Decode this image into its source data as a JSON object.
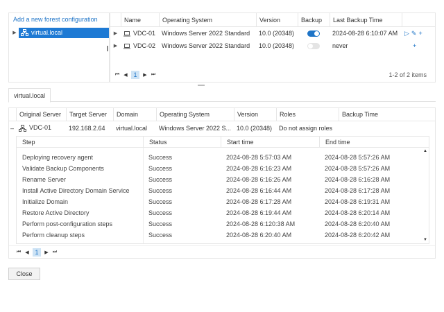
{
  "forest": {
    "add_link": "Add a new forest configuration",
    "tree": [
      {
        "label": "virtual.local",
        "selected": true
      }
    ]
  },
  "servers": {
    "columns": [
      "Name",
      "Operating System",
      "Version",
      "Backup",
      "Last Backup Time"
    ],
    "rows": [
      {
        "name": "VDC-01",
        "os": "Windows Server 2022 Standard",
        "version": "10.0 (20348)",
        "backup": true,
        "last_backup": "2024-08-28 6:10:07 AM"
      },
      {
        "name": "VDC-02",
        "os": "Windows Server 2022 Standard",
        "version": "10.0 (20348)",
        "backup": false,
        "last_backup": "never"
      }
    ],
    "pager": {
      "page": "1",
      "info": "1-2 of 2 items"
    }
  },
  "tabs": [
    {
      "label": "virtual.local"
    }
  ],
  "details": {
    "columns": [
      "Original Server",
      "Target Server",
      "Domain",
      "Operating System",
      "Version",
      "Roles",
      "Backup Time"
    ],
    "row": {
      "original_server": "VDC-01",
      "target_server": "192.168.2.64",
      "domain": "virtual.local",
      "os": "Windows Server 2022 S...",
      "version": "10.0 (20348)",
      "roles": "Do not assign roles",
      "backup_time": ""
    },
    "steps": {
      "columns": [
        "Step",
        "Status",
        "Start time",
        "End time"
      ],
      "rows": [
        {
          "step": "Deploying recovery agent",
          "status": "Success",
          "start": "2024-08-28 5:57:03 AM",
          "end": "2024-08-28 5:57:26 AM"
        },
        {
          "step": "Validate Backup Components",
          "status": "Success",
          "start": "2024-08-28 6:16:23 AM",
          "end": "2024-08-28 5:57:26 AM"
        },
        {
          "step": "Rename Server",
          "status": "Success",
          "start": "2024-08-28 6:16:26 AM",
          "end": "2024-08-28 6:16:28 AM"
        },
        {
          "step": "Install Active Directory Domain Service",
          "status": "Success",
          "start": "2024-08-28 6:16:44 AM",
          "end": "2024-08-28 6:17:28 AM"
        },
        {
          "step": "Initialize Domain",
          "status": "Success",
          "start": "2024-08-28 6:17:28 AM",
          "end": "2024-08-28 6:19:31 AM"
        },
        {
          "step": "Restore Active Directory",
          "status": "Success",
          "start": "2024-08-28 6:19:44 AM",
          "end": "2024-08-28 6:20:14 AM"
        },
        {
          "step": "Perform post-configuration steps",
          "status": "Success",
          "start": "2024-08-28 6:120:38 AM",
          "end": "2024-08-28 6:20:40 AM"
        },
        {
          "step": "Perform cleanup steps",
          "status": "Success",
          "start": "2024-08-28 6:20:40 AM",
          "end": "2024-08-28 6:20:42 AM"
        }
      ]
    },
    "pager": {
      "page": "1"
    }
  },
  "footer": {
    "close_label": "Close"
  },
  "colors": {
    "accent": "#1e74c7",
    "selection": "#1e7ad4",
    "pager_highlight": "#cde3f5"
  }
}
